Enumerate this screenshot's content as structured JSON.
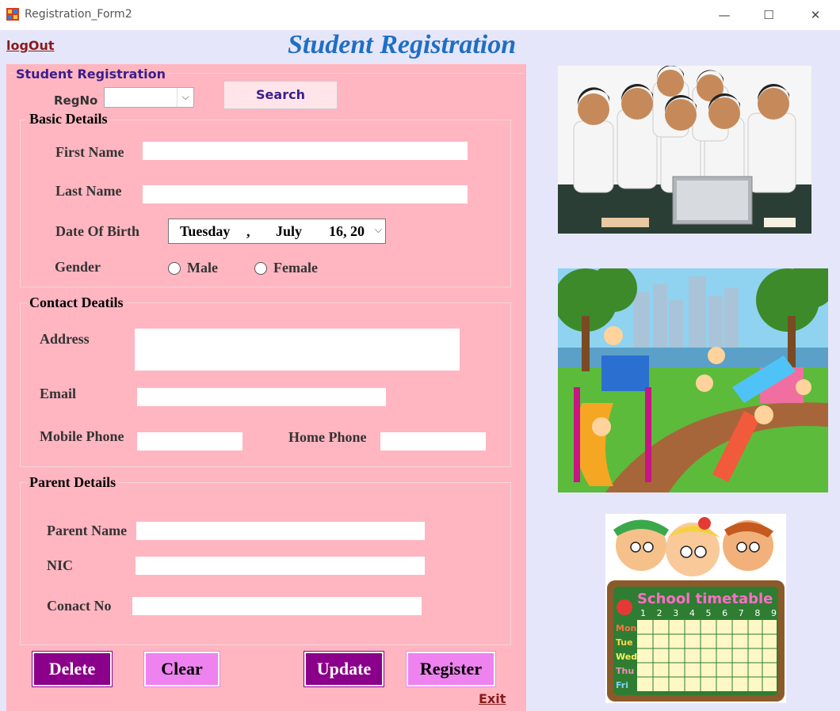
{
  "window": {
    "title": "Registration_Form2",
    "minimize": "—",
    "maximize": "☐",
    "close": "✕"
  },
  "header": {
    "logout": "logOut",
    "title": "Student Registration"
  },
  "form": {
    "group_title": "Student Registration",
    "regno_label": "RegNo",
    "regno_value": "",
    "search_button": "Search",
    "basic": {
      "title": "Basic Details",
      "first_name_label": "First Name",
      "last_name_label": "Last Name",
      "dob_label": "Date Of Birth",
      "dob_day": "Tuesday",
      "dob_sep": ",",
      "dob_month": "July",
      "dob_date": "16, 20",
      "gender_label": "Gender",
      "male": "Male",
      "female": "Female"
    },
    "contact": {
      "title": "Contact Deatils",
      "address_label": "Address",
      "email_label": "Email",
      "mobile_label": "Mobile Phone",
      "home_label": "Home Phone"
    },
    "parent": {
      "title": "Parent Details",
      "parent_name_label": "Parent Name",
      "nic_label": "NIC",
      "contact_label": "Conact No"
    },
    "buttons": {
      "delete": "Delete",
      "clear": "Clear",
      "update": "Update",
      "register": "Register"
    },
    "exit": "Exit"
  },
  "images": {
    "timetable_title": "School timetable",
    "timetable_days": [
      "Mon",
      "Tue",
      "Wed",
      "Thu",
      "Fri"
    ],
    "timetable_cols": [
      "1",
      "2",
      "3",
      "4",
      "5",
      "6",
      "7",
      "8",
      "9"
    ]
  },
  "colors": {
    "client_bg": "#e6e6fa",
    "form_bg": "#ffb6c1",
    "title_blue": "#1e6fc4",
    "dark_button": "#8b008b",
    "light_button": "#ee82ee"
  }
}
